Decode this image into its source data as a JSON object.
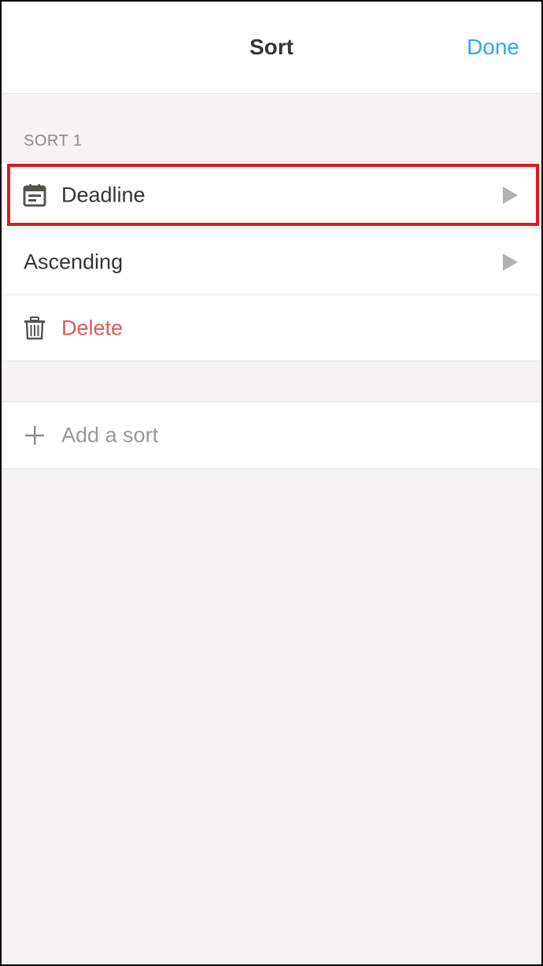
{
  "navbar": {
    "title": "Sort",
    "done_label": "Done"
  },
  "section": {
    "header": "SORT 1"
  },
  "sort_rows": {
    "property": {
      "label": "Deadline",
      "icon": "calendar-icon"
    },
    "direction": {
      "label": "Ascending"
    },
    "delete": {
      "label": "Delete",
      "icon": "trash-icon"
    }
  },
  "add_sort": {
    "label": "Add a sort",
    "icon": "plus-icon"
  },
  "colors": {
    "accent": "#2eaadc",
    "danger": "#e05a5f",
    "highlight": "#e0191e",
    "background": "#f5f4f2"
  }
}
